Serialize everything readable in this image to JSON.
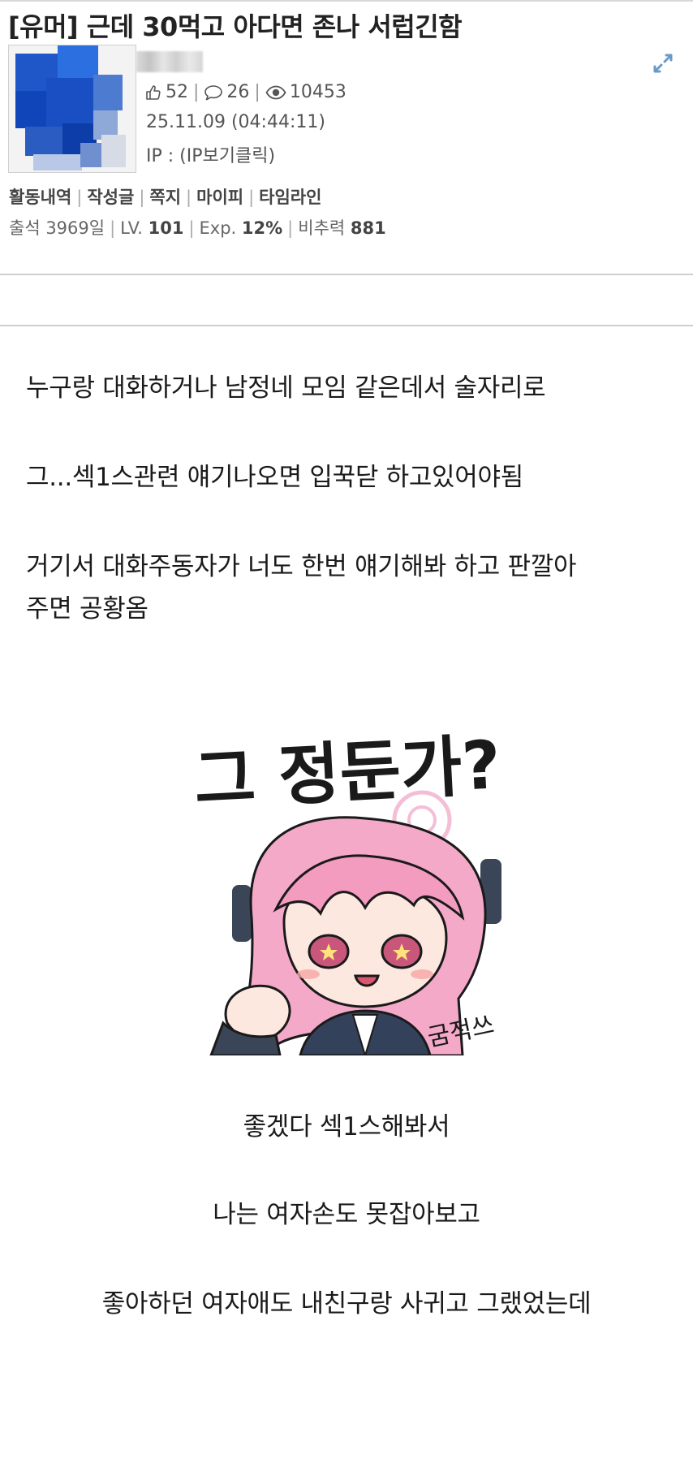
{
  "post": {
    "title": "[유머] 근데 30먹고 아다면 존나 서럽긴함",
    "stats": {
      "likes": "52",
      "comments": "26",
      "views": "10453"
    },
    "date": "25.11.09 (04:44:11)",
    "ip": "IP : (IP보기클릭)"
  },
  "author_links": {
    "activity": "활동내역",
    "posts": "작성글",
    "message": "쪽지",
    "mypi": "마이피",
    "timeline": "타임라인"
  },
  "author_levels": {
    "attendance_label": "출석 3969일",
    "lv_label": "LV.",
    "lv_value": "101",
    "exp_label": "Exp.",
    "exp_value": "12%",
    "ratio_label": "비추력",
    "ratio_value": "881"
  },
  "content": {
    "lines": [
      "누구랑 대화하거나 남정네 모임 같은데서 술자리로",
      "그...섹1스관련 얘기나오면 입꾹닫 하고있어야됨",
      "거기서 대화주동자가 너도 한번 얘기해봐 하고 판깔아",
      "주면 공황옴"
    ],
    "sticker": {
      "caption": "그 정둔가?",
      "sfx": "굼적쓰"
    },
    "center_lines": [
      "좋겠다 섹1스해봐서",
      "나는 여자손도 못잡아보고",
      "좋아하던 여자애도 내친구랑 사귀고 그랬었는데"
    ]
  },
  "icons": {
    "like": "thumbs-up-icon",
    "comment": "speech-bubble-icon",
    "view": "eye-icon",
    "expand": "expand-arrows-icon"
  },
  "colors": {
    "expand_icon": "#6b9ac9",
    "sticker_hair": "#f5a9c8",
    "sticker_outline": "#1a1a1a"
  }
}
